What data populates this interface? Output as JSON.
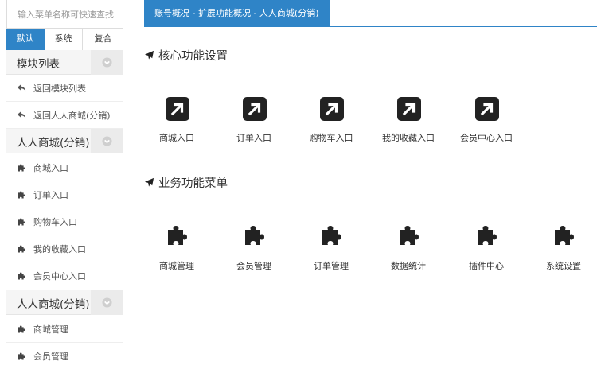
{
  "sidebar": {
    "search_placeholder": "输入菜单名称可快速查找",
    "tabs": [
      {
        "label": "默认",
        "active": true
      },
      {
        "label": "系统",
        "active": false
      },
      {
        "label": "复合",
        "active": false
      }
    ],
    "groups": [
      {
        "title": "模块列表",
        "items": [
          {
            "label": "返回模块列表",
            "icon": "reply-icon"
          },
          {
            "label": "返回人人商城(分销)",
            "icon": "reply-icon"
          }
        ]
      },
      {
        "title": "人人商城(分销)",
        "items": [
          {
            "label": "商城入口",
            "icon": "puzzle-icon"
          },
          {
            "label": "订单入口",
            "icon": "puzzle-icon"
          },
          {
            "label": "购物车入口",
            "icon": "puzzle-icon"
          },
          {
            "label": "我的收藏入口",
            "icon": "puzzle-icon"
          },
          {
            "label": "会员中心入口",
            "icon": "puzzle-icon"
          }
        ]
      },
      {
        "title": "人人商城(分销)",
        "items": [
          {
            "label": "商城管理",
            "icon": "puzzle-icon"
          },
          {
            "label": "会员管理",
            "icon": "puzzle-icon"
          }
        ]
      }
    ]
  },
  "main": {
    "breadcrumb": "账号概况 - 扩展功能概况 - 人人商城(分销)",
    "sections": [
      {
        "title": "核心功能设置",
        "icon": "plane-icon",
        "tiles": [
          {
            "label": "商城入口",
            "icon": "external-link-icon"
          },
          {
            "label": "订单入口",
            "icon": "external-link-icon"
          },
          {
            "label": "购物车入口",
            "icon": "external-link-icon"
          },
          {
            "label": "我的收藏入口",
            "icon": "external-link-icon"
          },
          {
            "label": "会员中心入口",
            "icon": "external-link-icon"
          }
        ]
      },
      {
        "title": "业务功能菜单",
        "icon": "plane-icon",
        "tiles": [
          {
            "label": "商城管理",
            "icon": "puzzle-icon"
          },
          {
            "label": "会员管理",
            "icon": "puzzle-icon"
          },
          {
            "label": "订单管理",
            "icon": "puzzle-icon"
          },
          {
            "label": "数据统计",
            "icon": "puzzle-icon"
          },
          {
            "label": "插件中心",
            "icon": "puzzle-icon"
          },
          {
            "label": "系统设置",
            "icon": "puzzle-icon"
          }
        ]
      }
    ]
  },
  "colors": {
    "accent": "#2f84c7",
    "icon_dark": "#222222"
  }
}
